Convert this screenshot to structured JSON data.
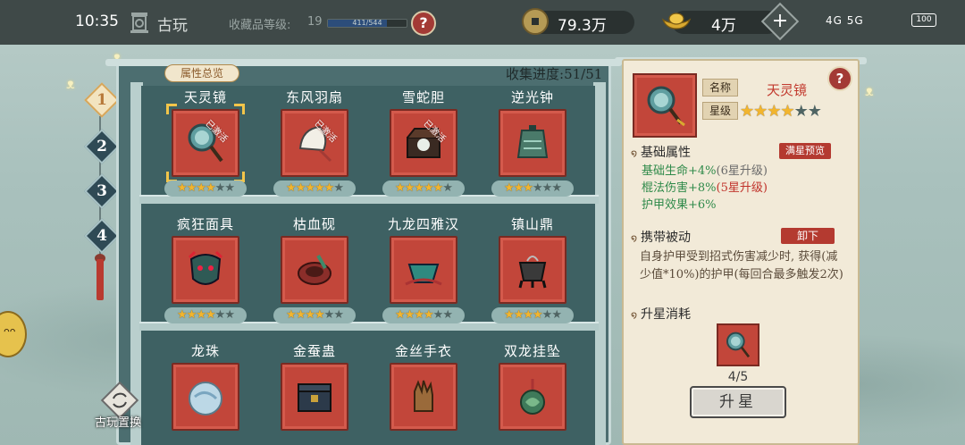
{
  "status_bar": {
    "time": "10:35",
    "signal_text": "4G 5G",
    "battery": "100"
  },
  "header": {
    "title": "古玩",
    "level_label": "收藏品等级:",
    "level_value": "19",
    "level_progress_text": "411/544",
    "level_progress_fraction": 0.755,
    "help_icon": "?",
    "coins": "79.3万",
    "gold": "4万",
    "add_icon": "+"
  },
  "tabs": [
    "1",
    "2",
    "3",
    "4"
  ],
  "active_tab": 0,
  "shelf": {
    "overview_label": "属性总览",
    "collect_label": "收集进度:",
    "collect_value": "51/51",
    "activated_label": "已激活",
    "items": [
      {
        "name": "天灵镜",
        "stars": 4,
        "max_stars": 6,
        "activated": true,
        "selected": true,
        "icon": "mirror-icon"
      },
      {
        "name": "东风羽扇",
        "stars": 5,
        "max_stars": 6,
        "activated": true,
        "selected": false,
        "icon": "feather-fan-icon"
      },
      {
        "name": "雪蛇胆",
        "stars": 5,
        "max_stars": 6,
        "activated": true,
        "selected": false,
        "icon": "box-icon"
      },
      {
        "name": "逆光钟",
        "stars": 3,
        "max_stars": 6,
        "activated": false,
        "selected": false,
        "icon": "bell-icon"
      },
      {
        "name": "疯狂面具",
        "stars": 4,
        "max_stars": 6,
        "activated": false,
        "selected": false,
        "icon": "mask-icon"
      },
      {
        "name": "枯血砚",
        "stars": 4,
        "max_stars": 6,
        "activated": false,
        "selected": false,
        "icon": "inkstone-icon"
      },
      {
        "name": "九龙四雅汉",
        "stars": 4,
        "max_stars": 6,
        "activated": false,
        "selected": false,
        "icon": "bowl-icon"
      },
      {
        "name": "镇山鼎",
        "stars": 4,
        "max_stars": 6,
        "activated": false,
        "selected": false,
        "icon": "cauldron-icon"
      },
      {
        "name": "龙珠",
        "stars": 0,
        "max_stars": 6,
        "activated": false,
        "selected": false,
        "icon": "orb-icon"
      },
      {
        "name": "金蚕蛊",
        "stars": 0,
        "max_stars": 6,
        "activated": false,
        "selected": false,
        "icon": "chest-icon"
      },
      {
        "name": "金丝手衣",
        "stars": 0,
        "max_stars": 6,
        "activated": false,
        "selected": false,
        "icon": "glove-icon"
      },
      {
        "name": "双龙挂坠",
        "stars": 0,
        "max_stars": 6,
        "activated": false,
        "selected": false,
        "icon": "pendant-icon"
      }
    ]
  },
  "swap_label": "古玩置换",
  "detail": {
    "name_tag": "名称",
    "name": "天灵镜",
    "star_tag": "星级",
    "stars": 4,
    "max_stars": 6,
    "base_title": "基础属性",
    "preview_button": "满星预览",
    "attrs": [
      {
        "text": "基础生命+4%",
        "note": "(6星升级)",
        "note_color": "gray"
      },
      {
        "text": "棍法伤害+8%",
        "note": "(5星升级)",
        "note_color": "red"
      },
      {
        "text": "护甲效果+6%",
        "note": "",
        "note_color": ""
      }
    ],
    "passive_title": "携带被动",
    "unload_button": "卸下",
    "passive_text": "自身护甲受到招式伤害减少时, 获得(减少值*10%)的护甲(每回合最多触发2次)",
    "cost_title": "升星消耗",
    "cost_count": "4/5",
    "star_up_button": "升星"
  },
  "colors": {
    "accent_red": "#c2463a",
    "shelf": "#4c6e70",
    "star": "#f2b52e"
  }
}
